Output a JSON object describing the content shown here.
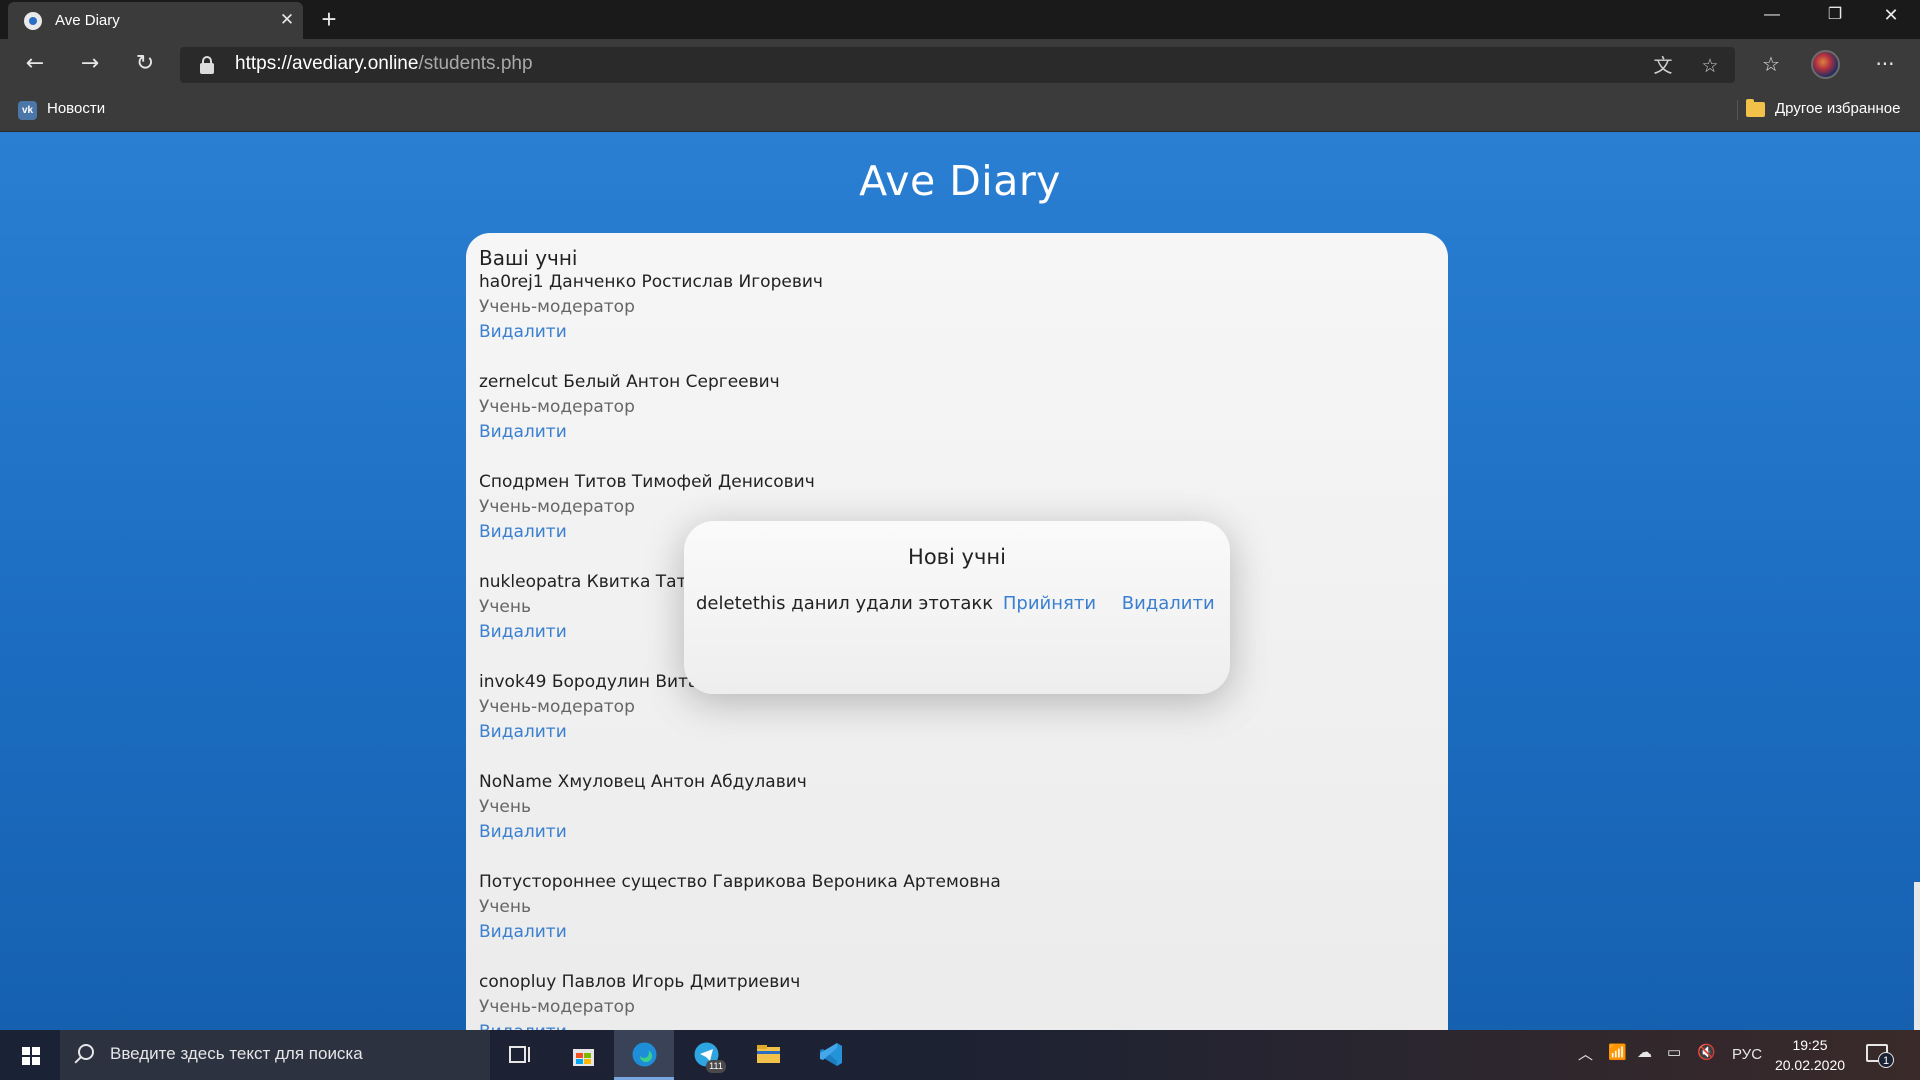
{
  "browser": {
    "tab_title": "Ave Diary",
    "url_host": "https://avediary.online",
    "url_path": "/students.php",
    "favorites": [
      {
        "label": "Новости"
      }
    ],
    "other_favorites": "Другое избранное"
  },
  "page": {
    "title": "Ave Diary",
    "students_heading": "Ваші учні",
    "delete_label": "Видалити",
    "students": [
      {
        "name": "ha0rej1 Данченко Ростислав Игоревич",
        "role": "Учень-модератор"
      },
      {
        "name": "zernelcut Белый Антон Сергеевич",
        "role": "Учень-модератор"
      },
      {
        "name": "Сподрмен Титов Тимофей Денисович",
        "role": "Учень-модератор"
      },
      {
        "name": "nukleopatra Квитка Тать",
        "role": "Учень"
      },
      {
        "name": "invok49 Бородулин Вита",
        "role": "Учень-модератор"
      },
      {
        "name": "NoName Хмуловец Антон Абдулавич",
        "role": "Учень"
      },
      {
        "name": "Потустороннее существо Гаврикова Вероника Артемовна",
        "role": "Учень"
      },
      {
        "name": "conopluy Павлов Игорь Дмитриевич",
        "role": "Учень-модератор"
      }
    ]
  },
  "modal": {
    "title": "Нові учні",
    "request_name": "deletethis данил удали этотакк",
    "accept_label": "Прийняти",
    "delete_label": "Видалити"
  },
  "taskbar": {
    "search_placeholder": "Введите здесь текст для поиска",
    "telegram_badge": "111",
    "language": "РУС",
    "time": "19:25",
    "date": "20.02.2020",
    "notification_count": "1"
  },
  "colors": {
    "accent": "#2a7fd3",
    "link": "#3a7fd0"
  }
}
